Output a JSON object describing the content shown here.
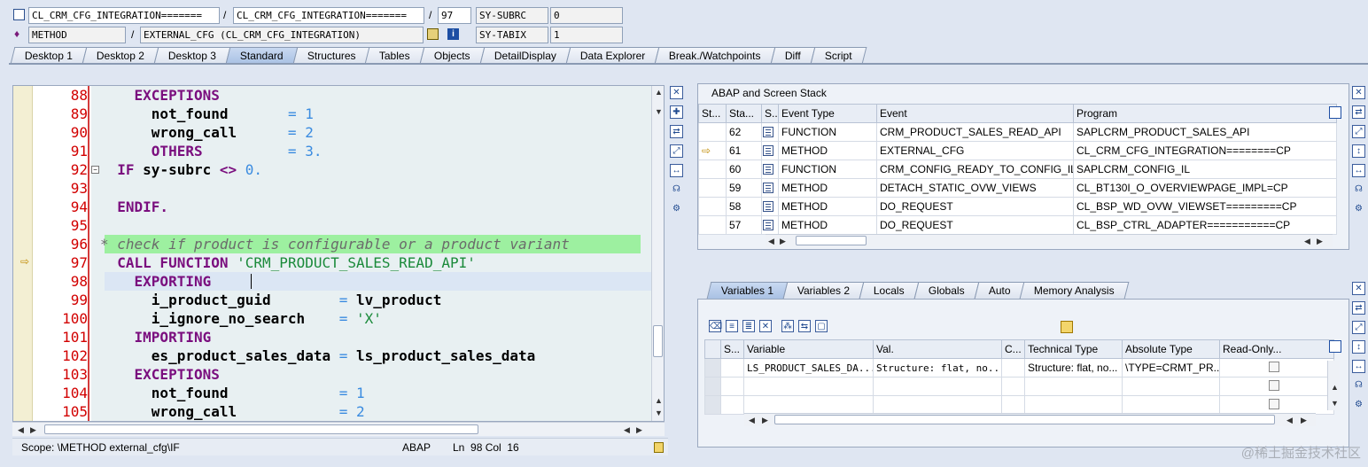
{
  "header": {
    "row1": {
      "program": "CL_CRM_CFG_INTEGRATION=======",
      "include": "CL_CRM_CFG_INTEGRATION=======",
      "line_sep": "/",
      "line": "97",
      "field_name": "SY-SUBRC",
      "field_value": "0"
    },
    "row2": {
      "kind": "METHOD",
      "event": "EXTERNAL_CFG (CL_CRM_CFG_INTEGRATION)",
      "field_name": "SY-TABIX",
      "field_value": "1"
    }
  },
  "tabs": [
    "Desktop 1",
    "Desktop 2",
    "Desktop 3",
    "Standard",
    "Structures",
    "Tables",
    "Objects",
    "DetailDisplay",
    "Data Explorer",
    "Break./Watchpoints",
    "Diff",
    "Script"
  ],
  "active_tab": "Standard",
  "code_lines": [
    {
      "n": "88",
      "html": "    <span class='kw'>EXCEPTIONS</span>"
    },
    {
      "n": "89",
      "html": "      <span class='id'>not_found</span>       <span class='num'>=</span> <span class='num'>1</span>"
    },
    {
      "n": "90",
      "html": "      <span class='id'>wrong_call</span>      <span class='num'>=</span> <span class='num'>2</span>"
    },
    {
      "n": "91",
      "html": "      <span class='kw'>OTHERS</span>          <span class='num'>=</span> <span class='num'>3.</span>"
    },
    {
      "n": "92",
      "html": "  <span class='kw'>IF</span> <span class='id'>sy-subrc</span> <span class='kw'>&lt;&gt;</span> <span class='num'>0.</span>"
    },
    {
      "n": "93",
      "html": ""
    },
    {
      "n": "94",
      "html": "  <span class='kw'>ENDIF.</span>"
    },
    {
      "n": "95",
      "html": ""
    },
    {
      "n": "96",
      "html": "<span class='cmt'>* check if product is configurable or a product variant</span>"
    },
    {
      "n": "97",
      "html": "  <span class='kw'>CALL FUNCTION</span> <span class='str'>'CRM_PRODUCT_SALES_READ_API'</span>"
    },
    {
      "n": "98",
      "html": "    <span class='kw'>EXPORTING</span>"
    },
    {
      "n": "99",
      "html": "      <span class='id'>i_product_guid</span>        <span class='num'>=</span> <span class='id'>lv_product</span>"
    },
    {
      "n": "100",
      "html": "      <span class='id'>i_ignore_no_search</span>    <span class='num'>=</span> <span class='str'>'X'</span>"
    },
    {
      "n": "101",
      "html": "    <span class='kw'>IMPORTING</span>"
    },
    {
      "n": "102",
      "html": "      <span class='id'>es_product_sales_data</span> <span class='num'>=</span> <span class='id'>ls_product_sales_data</span>"
    },
    {
      "n": "103",
      "html": "    <span class='kw'>EXCEPTIONS</span>"
    },
    {
      "n": "104",
      "html": "      <span class='id'>not_found</span>             <span class='num'>=</span> <span class='num'>1</span>"
    },
    {
      "n": "105",
      "html": "      <span class='id'>wrong_call</span>            <span class='num'>=</span> <span class='num'>2</span>"
    }
  ],
  "status": {
    "scope": "Scope: \\METHOD external_cfg\\IF",
    "lang": "ABAP",
    "ln": "Ln  98 Col  16"
  },
  "stack": {
    "title": "ABAP and Screen Stack",
    "columns": [
      "St...",
      "Sta...",
      "S...",
      "Event Type",
      "Event",
      "Program"
    ],
    "rows": [
      {
        "level": "62",
        "type": "FUNCTION",
        "event": "CRM_PRODUCT_SALES_READ_API",
        "program": "SAPLCRM_PRODUCT_SALES_API"
      },
      {
        "level": "61",
        "type": "METHOD",
        "event": "EXTERNAL_CFG",
        "program": "CL_CRM_CFG_INTEGRATION========CP"
      },
      {
        "level": "60",
        "type": "FUNCTION",
        "event": "CRM_CONFIG_READY_TO_CONFIG_IL",
        "program": "SAPLCRM_CONFIG_IL"
      },
      {
        "level": "59",
        "type": "METHOD",
        "event": "DETACH_STATIC_OVW_VIEWS",
        "program": "CL_BT130I_O_OVERVIEWPAGE_IMPL=CP"
      },
      {
        "level": "58",
        "type": "METHOD",
        "event": "DO_REQUEST",
        "program": "CL_BSP_WD_OVW_VIEWSET=========CP"
      },
      {
        "level": "57",
        "type": "METHOD",
        "event": "DO_REQUEST",
        "program": "CL_BSP_CTRL_ADAPTER===========CP"
      }
    ]
  },
  "var_tabs": [
    "Variables 1",
    "Variables 2",
    "Locals",
    "Globals",
    "Auto",
    "Memory Analysis"
  ],
  "vars": {
    "columns": [
      "S...",
      "Variable",
      "Val.",
      "C...",
      "Technical Type",
      "Absolute Type",
      "Read-Only..."
    ],
    "rows": [
      {
        "variable": "LS_PRODUCT_SALES_DA...",
        "value": "Structure: flat, no...",
        "tech": "Structure: flat, no...",
        "abs": "\\TYPE=CRMT_PR..."
      }
    ]
  },
  "watermark": "@稀土掘金技术社区"
}
